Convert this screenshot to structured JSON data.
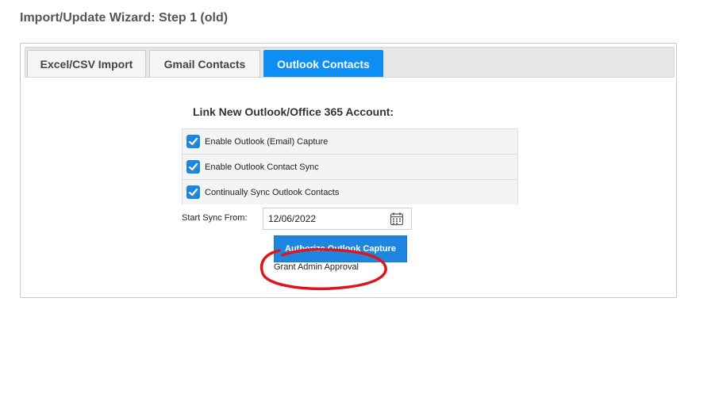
{
  "page": {
    "title": "Import/Update Wizard: Step 1 (old)"
  },
  "tabs": [
    {
      "label": "Excel/CSV Import",
      "active": false
    },
    {
      "label": "Gmail Contacts",
      "active": false
    },
    {
      "label": "Outlook Contacts",
      "active": true
    }
  ],
  "form": {
    "heading": "Link New Outlook/Office 365 Account:",
    "options": [
      {
        "label": "Enable Outlook (Email) Capture",
        "checked": true
      },
      {
        "label": "Enable Outlook Contact Sync",
        "checked": true
      },
      {
        "label": "Continually Sync Outlook Contacts",
        "checked": true
      }
    ],
    "sync_label": "Start Sync From:",
    "sync_date": "12/06/2022",
    "authorize_label": "Authorize Outlook Capture",
    "grant_label": "Grant Admin Approval"
  },
  "colors": {
    "accent": "#0d8ef2",
    "checkbox": "#1f86e0",
    "annotation": "#e0151b"
  },
  "icons": {
    "calendar": "calendar-icon",
    "check": "checkmark-icon"
  }
}
